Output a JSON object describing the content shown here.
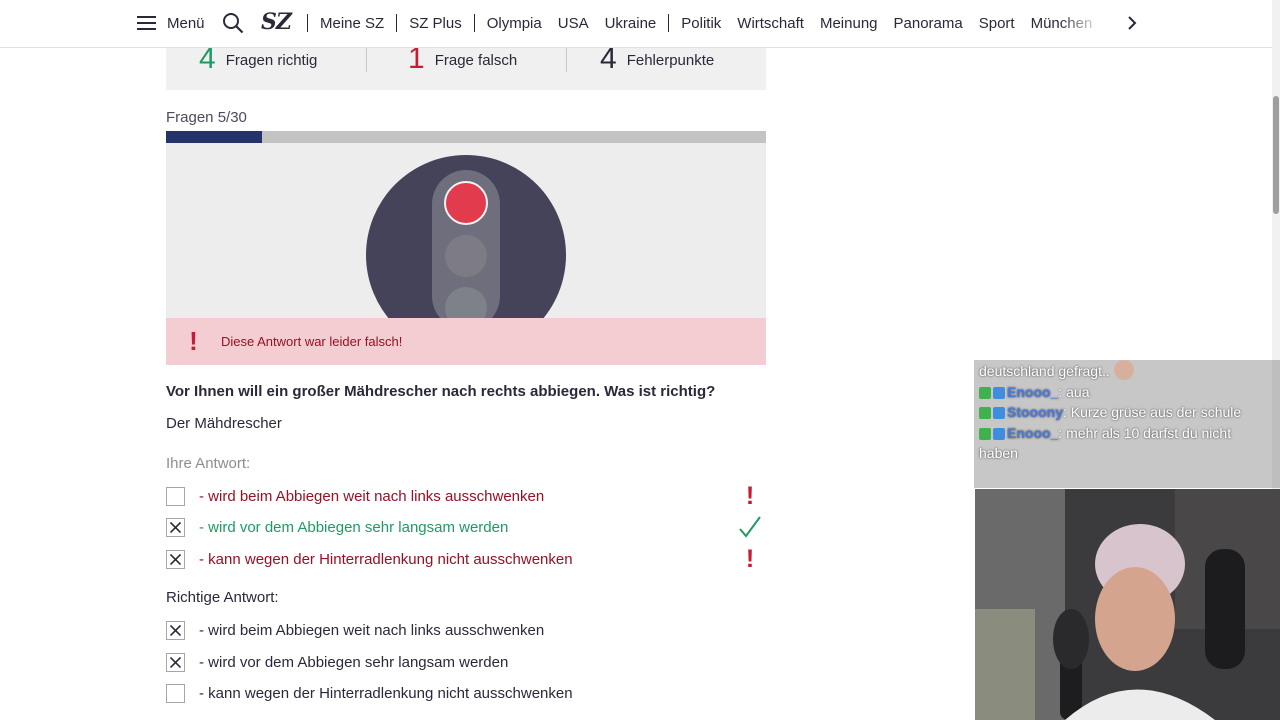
{
  "nav": {
    "menu_label": "Menü",
    "logo": "SZ",
    "links": [
      "Meine SZ",
      "SZ Plus",
      "Olympia",
      "USA",
      "Ukraine",
      "Politik",
      "Wirtschaft",
      "Meinung",
      "Panorama",
      "Sport",
      "München"
    ]
  },
  "score": {
    "correct_count": "4",
    "correct_label": "Fragen richtig",
    "wrong_count": "1",
    "wrong_label": "Frage falsch",
    "penalty_count": "4",
    "penalty_label": "Fehlerpunkte"
  },
  "progress": {
    "label": "Fragen 5/30",
    "fraction": 0.16
  },
  "feedback": {
    "icon": "!",
    "text": "Diese Antwort war leider falsch!"
  },
  "question": {
    "text": "Vor Ihnen will ein großer Mähdrescher nach rechts abbiegen. Was ist richtig?",
    "stem": "Der Mähdrescher"
  },
  "your_answer": {
    "label": "Ihre Antwort:",
    "options": [
      {
        "text": "- wird beim Abbiegen weit nach links ausschwenken",
        "checked": false,
        "result": "wrong"
      },
      {
        "text": "- wird vor dem Abbiegen sehr langsam werden",
        "checked": true,
        "result": "right"
      },
      {
        "text": "- kann wegen der Hinterradlenkung nicht ausschwenken",
        "checked": true,
        "result": "wrong"
      }
    ]
  },
  "correct_answer": {
    "label": "Richtige Antwort:",
    "options": [
      {
        "text": "- wird beim Abbiegen weit nach links ausschwenken",
        "checked": true
      },
      {
        "text": "- wird vor dem Abbiegen sehr langsam werden",
        "checked": true
      },
      {
        "text": "- kann wegen der Hinterradlenkung nicht ausschwenken",
        "checked": false
      }
    ]
  },
  "chat": {
    "lines": [
      {
        "user": "",
        "text": "deutschland gefragt.."
      },
      {
        "user": "Enooo_",
        "text": ": aua"
      },
      {
        "user": "Stooony",
        "text": ": Kurze grüse aus der schule"
      },
      {
        "user": "Enooo_",
        "text": ": mehr als 10 darfst du nicht haben"
      }
    ]
  },
  "colors": {
    "accent_navy": "#25336b",
    "correct_green": "#1f9a61",
    "wrong_red": "#9a0f24",
    "feedback_bg": "#f4cdd2"
  },
  "icons": [
    "menu-icon",
    "search-icon",
    "chevron-right-icon",
    "checkmark-icon",
    "exclamation-icon",
    "traffic-light-icon"
  ]
}
